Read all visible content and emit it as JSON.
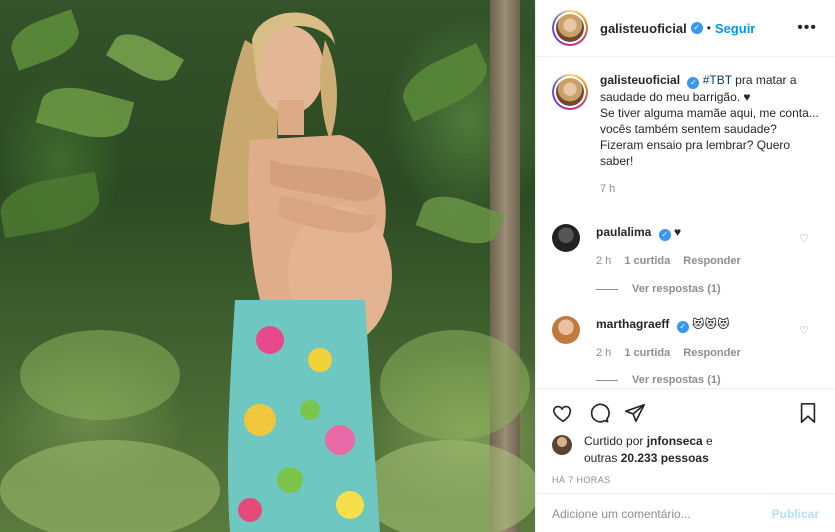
{
  "post": {
    "author": "galisteuoficial",
    "follow_label": "Seguir",
    "dot": "•",
    "more_icon": "more-horizontal-icon"
  },
  "caption": {
    "username": "galisteuoficial",
    "hashtag": "#TBT",
    "text_1": " pra matar a saudade do meu barrigão. ♥",
    "text_2": "Se tiver alguma mamãe aqui, me conta... vocês também sentem saudade? Fizeram ensaio pra lembrar? Quero saber!",
    "time": "7 h"
  },
  "comments": [
    {
      "username": "paulalima",
      "text": "♥",
      "time": "2 h",
      "likes": "1 curtida",
      "reply_label": "Responder",
      "view_replies": "Ver respostas (1)"
    },
    {
      "username": "marthagraeff",
      "text": "😻😻😻",
      "time": "2 h",
      "likes": "1 curtida",
      "reply_label": "Responder",
      "view_replies": "Ver respostas (1)"
    }
  ],
  "likes": {
    "prefix": "Curtido por ",
    "user": "jnfonseca",
    "middle": " e",
    "line2_prefix": "outras ",
    "count": "20.233 pessoas"
  },
  "time_ago": "HÁ 7 HORAS",
  "add_comment": {
    "placeholder": "Adicione um comentário...",
    "publish_label": "Publicar"
  },
  "colors": {
    "link_blue": "#0095f6",
    "verified_blue": "#3897f0",
    "muted": "#8e8e8e",
    "publish_disabled": "#b2dffc"
  }
}
